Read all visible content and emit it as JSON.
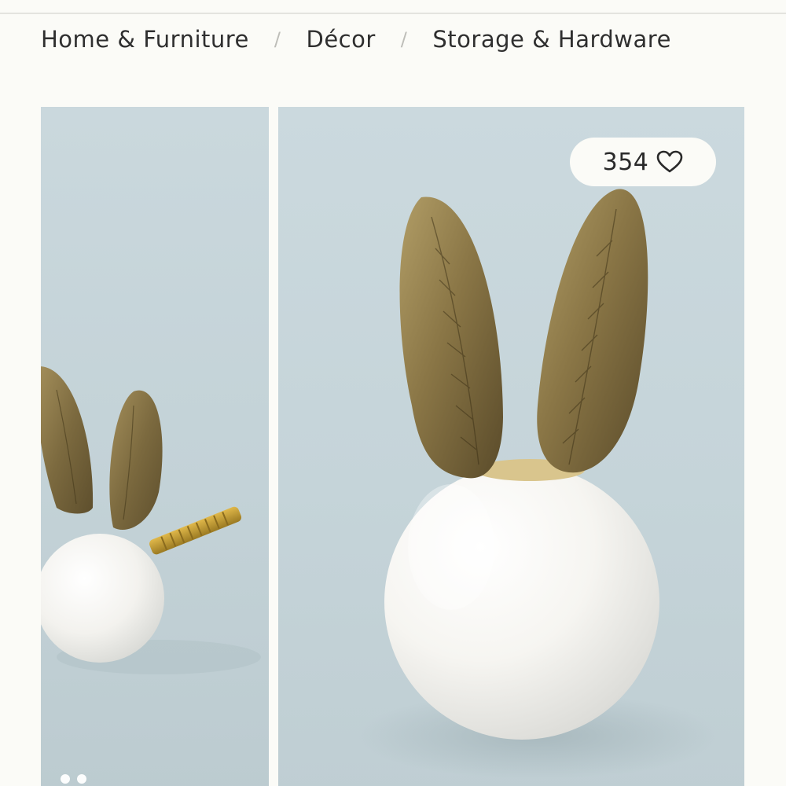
{
  "breadcrumb": {
    "items": [
      {
        "label": "Home & Furniture"
      },
      {
        "label": "Décor"
      },
      {
        "label": "Storage & Hardware"
      }
    ],
    "separator": "/"
  },
  "product": {
    "like_count": "354",
    "like_icon": "heart-outline-icon",
    "gallery_dots": 2
  },
  "colors": {
    "background": "#fbfbf7",
    "image_backdrop": "#c7d6db",
    "knob_white": "#f7f6f2",
    "ear_brass": "#8f7a48"
  }
}
